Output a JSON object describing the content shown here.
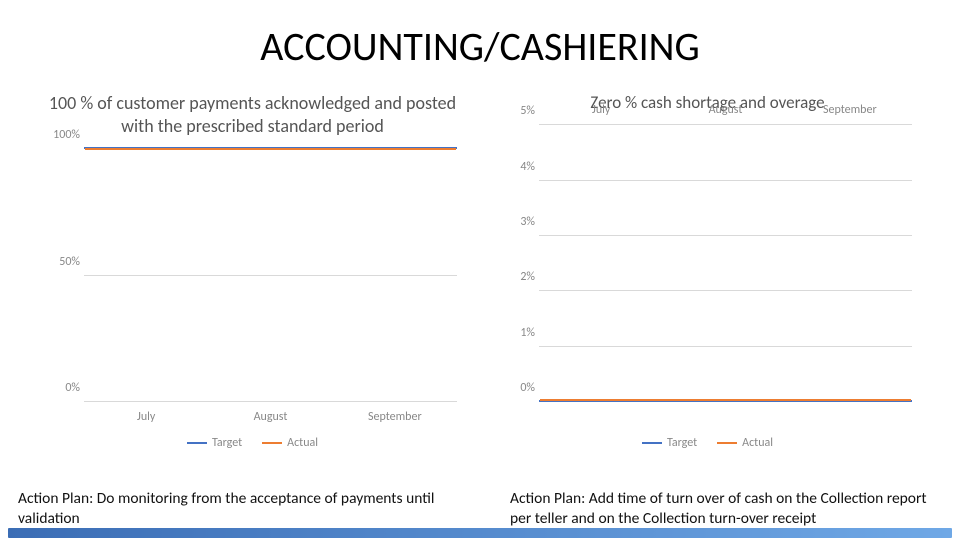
{
  "title": "ACCOUNTING/CASHIERING",
  "left": {
    "chart_title": "100 % of customer payments acknowledged and posted with the prescribed standard period",
    "action": "Action Plan: Do monitoring from the acceptance of payments until validation",
    "legend_target": "Target",
    "legend_actual": "Actual",
    "xticks": {
      "a": "July",
      "b": "August",
      "c": "September"
    },
    "yticks": {
      "y0": "0%",
      "y50": "50%",
      "y100": "100%"
    }
  },
  "right": {
    "chart_title": "Zero % cash shortage and overage",
    "action": "Action Plan: Add time of turn over of cash on the Collection report per teller and on the Collection turn-over receipt",
    "legend_target": "Target",
    "legend_actual": "Actual",
    "xticks": {
      "a": "July",
      "b": "August",
      "c": "September"
    },
    "yticks": {
      "y0": "0%",
      "y1": "1%",
      "y2": "2%",
      "y3": "3%",
      "y4": "4%",
      "y5": "5%"
    }
  },
  "chart_data": [
    {
      "type": "line",
      "title": "100 % of customer payments acknowledged and posted with the prescribed standard period",
      "categories": [
        "July",
        "August",
        "September"
      ],
      "series": [
        {
          "name": "Target",
          "values": [
            100,
            100,
            100
          ],
          "color": "#4472c4"
        },
        {
          "name": "Actual",
          "values": [
            100,
            100,
            100
          ],
          "color": "#ed7d31"
        }
      ],
      "xlabel": "",
      "ylabel": "",
      "ylim": [
        0,
        100
      ],
      "y_ticks": [
        0,
        50,
        100
      ],
      "y_format": "percent"
    },
    {
      "type": "line",
      "title": "Zero % cash shortage and overage",
      "categories": [
        "July",
        "August",
        "September"
      ],
      "series": [
        {
          "name": "Target",
          "values": [
            0,
            0,
            0
          ],
          "color": "#4472c4"
        },
        {
          "name": "Actual",
          "values": [
            0,
            0,
            0
          ],
          "color": "#ed7d31"
        }
      ],
      "xlabel": "",
      "ylabel": "",
      "ylim": [
        0,
        5
      ],
      "y_ticks": [
        0,
        1,
        2,
        3,
        4,
        5
      ],
      "y_format": "percent"
    }
  ]
}
